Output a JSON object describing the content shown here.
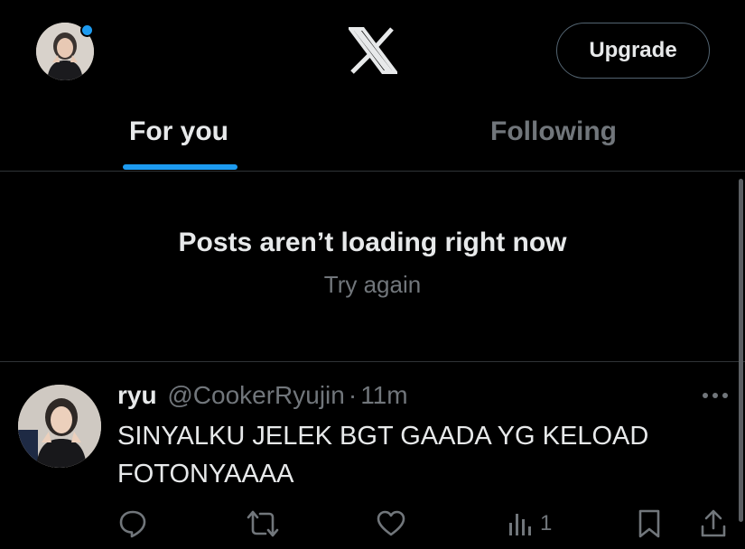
{
  "header": {
    "logo_icon": "x-logo-icon",
    "upgrade_label": "Upgrade"
  },
  "tabs": [
    {
      "label": "For you",
      "active": true
    },
    {
      "label": "Following",
      "active": false
    }
  ],
  "feed_error": {
    "title": "Posts aren’t loading right now",
    "retry_label": "Try again"
  },
  "post": {
    "name": "ryu",
    "handle": "@CookerRyujin",
    "separator": "·",
    "time": "11m",
    "text": "SINYALKU JELEK BGT GAADA YG KELOAD FOTONYAAAA",
    "actions": {
      "reply_icon": "reply-icon",
      "repost_icon": "repost-icon",
      "like_icon": "heart-icon",
      "views_icon": "views-icon",
      "views_count": "1",
      "bookmark_icon": "bookmark-icon",
      "share_icon": "share-icon"
    }
  },
  "colors": {
    "background": "#000000",
    "text_primary": "#e7e9ea",
    "text_secondary": "#71767b",
    "accent": "#1d9bf0",
    "divider": "#2f3336"
  }
}
